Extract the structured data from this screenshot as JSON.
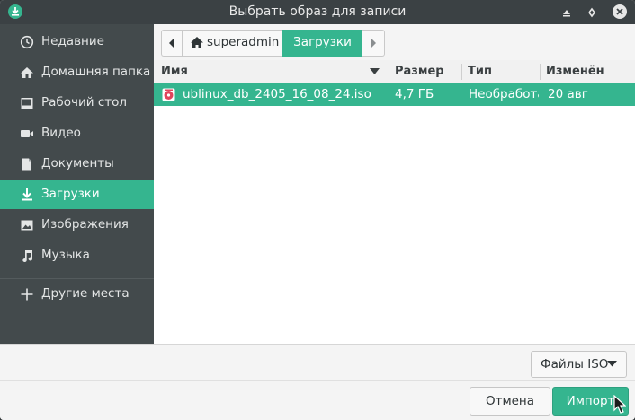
{
  "window": {
    "title": "Выбрать образ для записи"
  },
  "sidebar": {
    "items": [
      {
        "label": "Недавние",
        "icon": "clock-icon"
      },
      {
        "label": "Домашняя папка",
        "icon": "home-icon"
      },
      {
        "label": "Рабочий стол",
        "icon": "desktop-icon"
      },
      {
        "label": "Видео",
        "icon": "video-icon"
      },
      {
        "label": "Документы",
        "icon": "document-icon"
      },
      {
        "label": "Загрузки",
        "icon": "download-icon"
      },
      {
        "label": "Изображения",
        "icon": "image-icon"
      },
      {
        "label": "Музыка",
        "icon": "music-icon"
      }
    ],
    "other": {
      "label": "Другие места",
      "icon": "plus-icon"
    }
  },
  "pathbar": {
    "home": "superadmin",
    "current": "Загрузки"
  },
  "columns": {
    "name": "Имя",
    "size": "Размер",
    "type": "Тип",
    "modified": "Изменён"
  },
  "files": [
    {
      "name": "ublinux_db_2405_16_08_24.iso",
      "size": "4,7 ГБ",
      "type": "Необработа",
      "modified": "20 авг"
    }
  ],
  "filter": {
    "label": "Файлы ISO"
  },
  "buttons": {
    "cancel": "Отмена",
    "import": "Импорт"
  },
  "colors": {
    "accent": "#35b58f",
    "sidebar": "#434a4c",
    "titlebar": "#3b4144"
  }
}
